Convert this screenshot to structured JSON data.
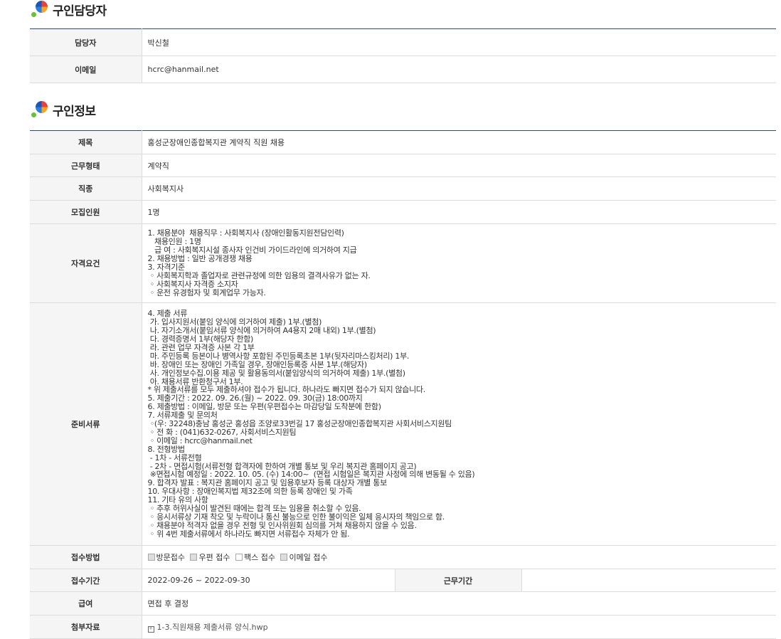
{
  "contact_section": {
    "title": "구인담당자",
    "rows": [
      {
        "label": "담당자",
        "value": "박신철"
      },
      {
        "label": "이메일",
        "value": "hcrc@hanmail.net"
      }
    ]
  },
  "job_section": {
    "title": "구인정보",
    "title_row": {
      "label": "제목",
      "value": "홍성군장애인종합복지관 계약직 직원 채용"
    },
    "employment_type": {
      "label": "근무형태",
      "value": "계약직"
    },
    "job_category": {
      "label": "직종",
      "value": "사회복지사"
    },
    "headcount": {
      "label": "모집인원",
      "value": "1명"
    },
    "qualifications": {
      "label": "자격요건",
      "text": "1. 채용분야  채용직무 : 사회복지사 (장애인활동지원전담인력)\n   채용인원 : 1명\n   급 여 : 사회복지시설 종사자 인건비 가이드라인에 의거하여 지급\n2. 채용방법 : 일반 공개경쟁 채용\n3. 자격기준\n ◦ 사회복지학과 졸업자로 관련규정에 의한 임용의 결격사유가 없는 자.\n ◦ 사회복지사 자격증 소지자\n ◦ 운전 유경험자 및 회계업무 가능자."
    },
    "documents": {
      "label": "준비서류",
      "text": "4. 제출 서류\n 가. 입사지원서(붙임 양식에 의거하여 제출) 1부.(별첨)\n 나. 자기소개서(붙임서류 양식에 의거하여 A4용지 2매 내외) 1부.(별첨)\n 다. 경력증명서 1부(해당자 한함)\n 라. 관련 업무 자격증 사본 각 1부\n 마. 주민등록 등본이나 병역사항 포함된 주민등록초본 1부(뒷자리마스킹처리) 1부.\n 바. 장애인 또는 장애인 가족일 경우, 장애인등록증 사본 1부.(해당자)\n 사. 개인정보수집.이용 제공 및 활용동의서(붙임양식의 의거하여 제출) 1부.(별첨)\n 아. 채용서류 반환청구서 1부.\n* 위 제출서류를 모두 제출하셔야 접수가 됩니다. 하나라도 빠지면 접수가 되지 않습니다.\n5. 제출기간 : 2022. 09. 26.(월) ~ 2022. 09. 30(금) 18:00까지\n6. 제출방법 : 이메일, 방문 또는 우편(우편접수는 마감당일 도착분에 한함)\n7. 서류제출 및 문의처\n ◦(우: 32248)충남 홍성군 홍성읍 조양로33번길 17 홍성군장애인종합복지관 사회서비스지원팀\n ◦ 전 화 : (041)632-0267, 사회서비스지원팀\n ◦ 이메일 : hcrc@hanmail.net\n8. 전형방법\n - 1차 - 서류전형\n - 2차 - 면접시험(서류전형 합격자에 한하여 개별 통보 및 우리 복지관 홈페이지 공고)\n ※면접시험 예정일 : 2022. 10. 05. (수) 14:00~  (면접 시험일은 복지관 사정에 의해 변동될 수 있음)\n9. 합격자 발표 : 복지관 홈페이지 공고 및 임용후보자 등록 대상자 개별 통보\n10. 우대사항 : 장애인복지법 제32조에 의한 등록 장애인 및 가족\n11. 기타 유의 사항\n ◦ 추후 허위사실이 발견된 때에는 합격 또는 임용을 취소할 수 있음.\n ◦ 응시서류상 기재 착오 및 누락이나 통신 불능으로 인한 불이익은 일체 응시자의 책임으로 함.\n ◦ 채용분야 적격자 없을 경우 전형 및 인사위원회 심의를 거쳐 채용하지 않을 수 있음.\n ◦ 위 4번 제출서류에서 하나라도 빠지면 서류접수 자체가 안 됨."
    },
    "application_method": {
      "label": "접수방법",
      "options": [
        {
          "label": "방문접수",
          "checked": true
        },
        {
          "label": "우편 접수",
          "checked": true
        },
        {
          "label": "팩스 접수",
          "checked": false
        },
        {
          "label": "이메일 접수",
          "checked": true
        }
      ]
    },
    "application_period": {
      "label": "접수기간",
      "value": "2022-09-26 ~ 2022-09-30"
    },
    "work_period": {
      "label": "근무기간",
      "value": ""
    },
    "salary": {
      "label": "급여",
      "value": "면접 후 결정"
    },
    "attachment": {
      "label": "첨부자료",
      "file": "1-3.직원채용 제출서류 양식.hwp"
    }
  }
}
